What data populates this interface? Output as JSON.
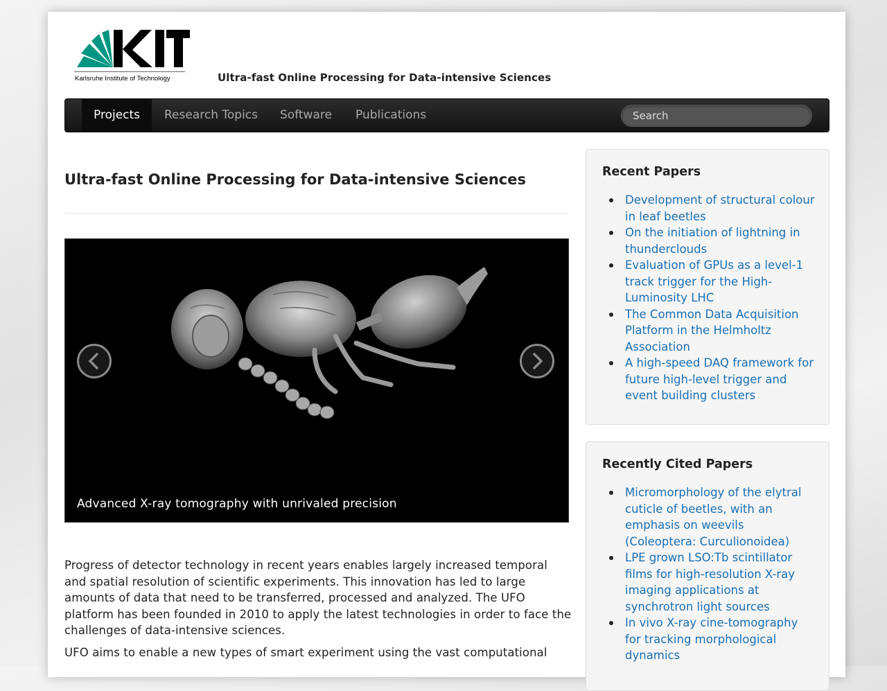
{
  "header": {
    "logo_subtitle": "Karlsruhe Institute of Technology",
    "logo_text": "KIT",
    "site_title": "Ultra-fast Online Processing for Data-intensive Sciences"
  },
  "nav": {
    "items": [
      {
        "label": "Projects",
        "active": true
      },
      {
        "label": "Research Topics",
        "active": false
      },
      {
        "label": "Software",
        "active": false
      },
      {
        "label": "Publications",
        "active": false
      }
    ],
    "search_placeholder": "Search"
  },
  "main": {
    "title": "Ultra-fast Online Processing for Data-intensive Sciences",
    "carousel": {
      "caption": "Advanced X-ray tomography with unrivaled precision",
      "prev_icon": "chevron-left-icon",
      "next_icon": "chevron-right-icon"
    },
    "paragraphs": [
      "Progress of detector technology in recent years enables largely increased temporal and spatial resolution of scientific experiments. This innovation has  led to large amounts of data that need to be transferred, processed and analyzed. The UFO platform has been founded in 2010 to apply the latest technologies in order to face the challenges of data-intensive sciences.",
      "UFO aims to enable a new types of smart experiment using the vast computational"
    ]
  },
  "sidebar": {
    "recent_papers": {
      "title": "Recent Papers",
      "items": [
        "Development of structural colour in leaf beetles",
        "On the initiation of lightning in thunderclouds",
        "Evaluation of GPUs as a level-1 track trigger for the High-Luminosity LHC",
        "The Common Data Acquisition Platform in the Helmholtz Association",
        "A high-speed DAQ framework for future high-level trigger and event building clusters"
      ]
    },
    "recently_cited": {
      "title": "Recently Cited Papers",
      "items": [
        "Micromorphology of the elytral cuticle of beetles, with an emphasis on weevils (Coleoptera: Curculionoidea)",
        "LPE grown LSO:Tb scintillator films for high-resolution X-ray imaging applications at synchrotron light sources",
        "In vivo X-ray cine-tomography for tracking morphological dynamics"
      ]
    }
  },
  "colors": {
    "link": "#1a6fb3",
    "kit_green": "#009682",
    "navbar": "#1b1b1b"
  }
}
